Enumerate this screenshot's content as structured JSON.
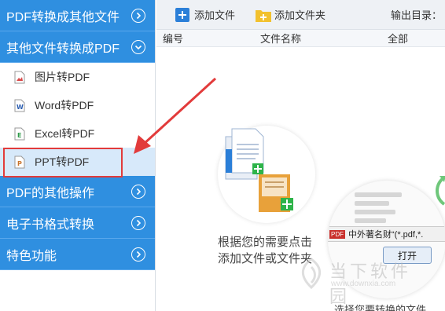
{
  "sidebar": {
    "categories": [
      {
        "label": "PDF转换成其他文件"
      },
      {
        "label": "其他文件转换成PDF"
      },
      {
        "label": "PDF的其他操作"
      },
      {
        "label": "电子书格式转换"
      },
      {
        "label": "特色功能"
      }
    ],
    "sub_items": [
      {
        "label": "图片转PDF",
        "icon": "image-file-icon"
      },
      {
        "label": "Word转PDF",
        "icon": "word-file-icon"
      },
      {
        "label": "Excel转PDF",
        "icon": "excel-file-icon"
      },
      {
        "label": "PPT转PDF",
        "icon": "ppt-file-icon",
        "selected": true
      }
    ]
  },
  "toolbar": {
    "add_file": "添加文件",
    "add_folder": "添加文件夹",
    "output_dir": "输出目录："
  },
  "table": {
    "headers": [
      "编号",
      "文件名称",
      "全部"
    ]
  },
  "empty_state": {
    "hint_line1": "根据您的需要点击",
    "hint_line2": "添加文件或文件夹"
  },
  "dialog_preview": {
    "file_text": "中外著名财“(*.pdf,*.",
    "pdf_badge": "PDF",
    "open_button": "打开",
    "caption": "选择您要转换的文件"
  },
  "watermark": {
    "text": "当下软件园",
    "url": "www.downxia.com"
  },
  "colors": {
    "sidebar_blue": "#2f8fe0",
    "selected_bg": "#d7e9fa",
    "highlight_red": "#e23b3b",
    "add_green": "#2eb44a"
  }
}
